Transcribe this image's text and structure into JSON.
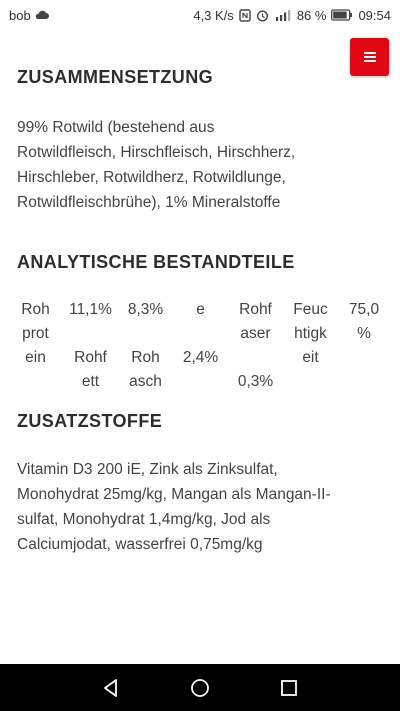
{
  "status_bar": {
    "carrier": "bob",
    "speed": "4,3 K/s",
    "battery": "86 %",
    "time": "09:54",
    "icons": [
      "cloud-icon",
      "nfc-icon",
      "alarm-icon",
      "signal-icon",
      "battery-icon"
    ]
  },
  "menu_button": {
    "label": "≡",
    "color": "#e30613"
  },
  "composition": {
    "title": "ZUSAMMENSETZUNG",
    "lines": [
      "99% Rotwild (bestehend aus",
      "Rotwildfleisch, Hirschfleisch, Hirschherz,",
      "Hirschleber, Rotwildherz, Rotwildlunge,",
      "Rotwildfleischbrühe), 1% Mineralstoffe"
    ]
  },
  "analytical": {
    "title": "ANALYTISCHE BESTANDTEILE",
    "cells": [
      "Roh\nprot\nein",
      "11,1%\n\nRohf\nett",
      "8,3%\n\nRoh\nasch",
      "e\n\n2,4%",
      "Rohf\naser\n\n0,3%",
      "Feuc\nhtigk\neit",
      "75,0\n%"
    ]
  },
  "additives": {
    "title": "ZUSATZSTOFFE",
    "lines": [
      "Vitamin D3 200 iE, Zink als Zinksulfat,",
      "Monohydrat 25mg/kg, Mangan als Mangan-II-",
      "sulfat, Monohydrat 1,4mg/kg, Jod als",
      "Calciumjodat, wasserfrei 0,75mg/kg"
    ]
  },
  "nav_bar": {
    "buttons": [
      "back-icon",
      "home-icon",
      "recents-icon"
    ]
  }
}
